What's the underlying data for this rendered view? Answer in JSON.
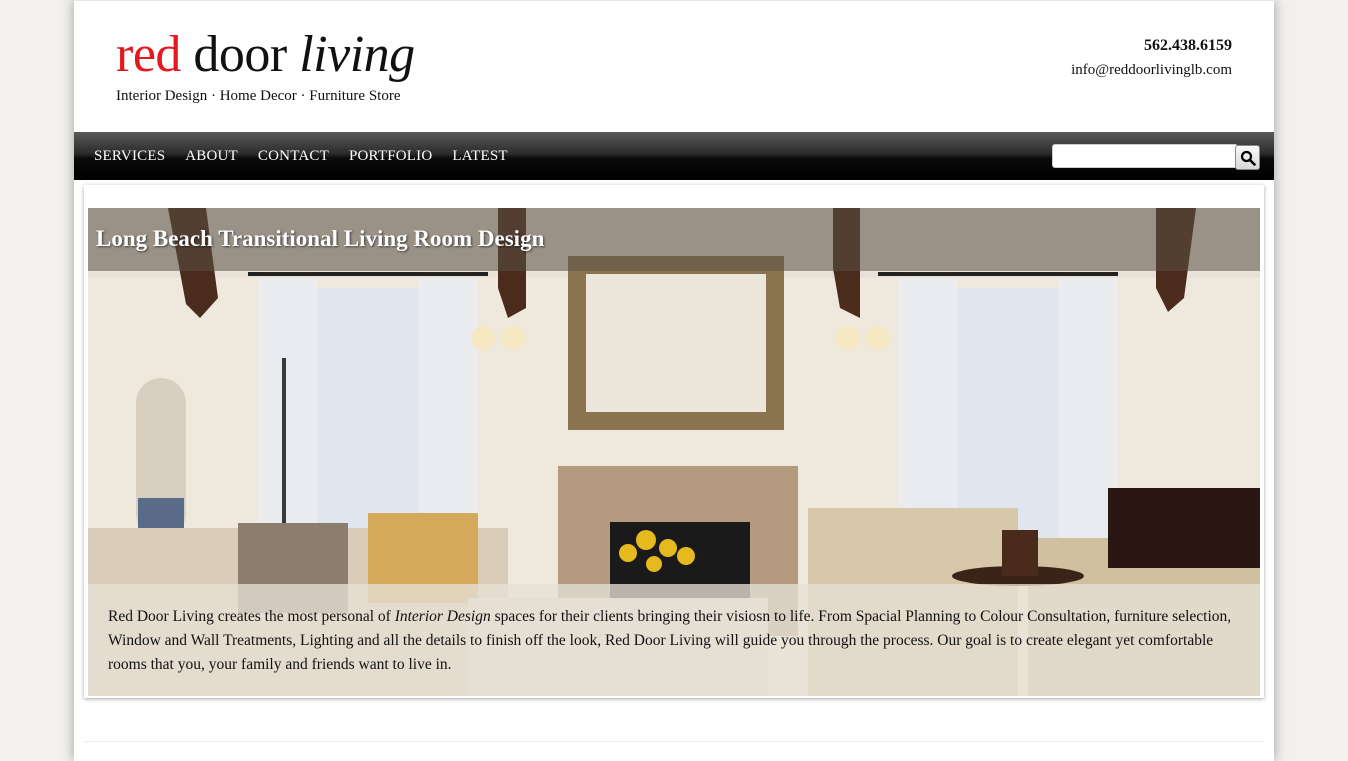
{
  "header": {
    "logo_red": "red",
    "logo_door": "door",
    "logo_living": "living",
    "tagline": "Interior Design · Home Decor · Furniture Store",
    "phone": "562.438.6159",
    "email": "info@reddoorlivinglb.com"
  },
  "nav": {
    "items": [
      {
        "label": "SERVICES"
      },
      {
        "label": "ABOUT"
      },
      {
        "label": "CONTACT"
      },
      {
        "label": "PORTFOLIO"
      },
      {
        "label": "LATEST"
      }
    ],
    "search_icon": "magnifier-icon",
    "search_placeholder": ""
  },
  "hero": {
    "title": "Long Beach Transitional Living Room Design",
    "caption_before": "Red Door Living creates the most personal of ",
    "caption_em": "Interior Design",
    "caption_after": " spaces for their clients bringing their visiosn to life. From Spacial Planning to Colour Consultation, furniture selection, Window and Wall Treatments, Lighting and all the details to finish off the look, Red Door Living will guide you through the process. Our goal is to create elegant yet comfortable rooms that you, your family and friends want to live in."
  },
  "colors": {
    "brand_red": "#e5171f",
    "navbar": "#000000"
  }
}
